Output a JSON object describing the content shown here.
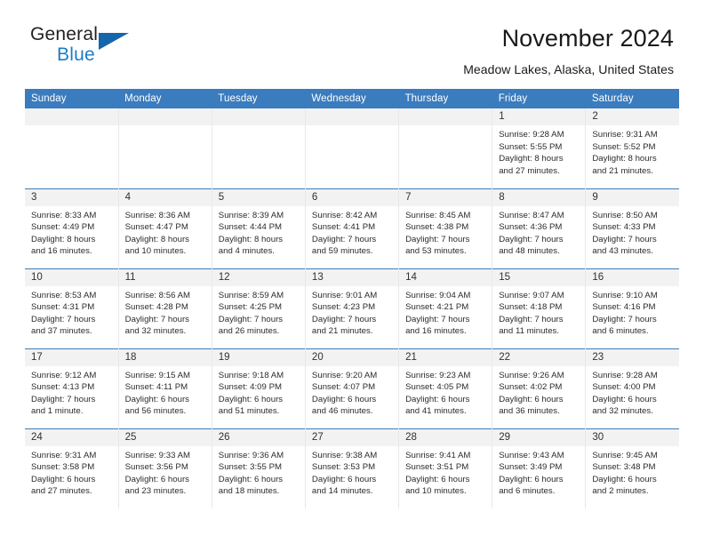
{
  "brand": {
    "name_top": "General",
    "name_bottom": "Blue",
    "accent": "#1d7cc4",
    "triangle_color": "#1566ab"
  },
  "header": {
    "title": "November 2024",
    "subtitle": "Meadow Lakes, Alaska, United States"
  },
  "calendar": {
    "header_bg": "#3a7cbe",
    "daynum_bg": "#f2f2f2",
    "weekdays": [
      "Sunday",
      "Monday",
      "Tuesday",
      "Wednesday",
      "Thursday",
      "Friday",
      "Saturday"
    ],
    "weeks": [
      [
        {
          "day": "",
          "sunrise": "",
          "sunset": "",
          "daylight1": "",
          "daylight2": "",
          "empty": true
        },
        {
          "day": "",
          "sunrise": "",
          "sunset": "",
          "daylight1": "",
          "daylight2": "",
          "empty": true
        },
        {
          "day": "",
          "sunrise": "",
          "sunset": "",
          "daylight1": "",
          "daylight2": "",
          "empty": true
        },
        {
          "day": "",
          "sunrise": "",
          "sunset": "",
          "daylight1": "",
          "daylight2": "",
          "empty": true
        },
        {
          "day": "",
          "sunrise": "",
          "sunset": "",
          "daylight1": "",
          "daylight2": "",
          "empty": true
        },
        {
          "day": "1",
          "sunrise": "Sunrise: 9:28 AM",
          "sunset": "Sunset: 5:55 PM",
          "daylight1": "Daylight: 8 hours",
          "daylight2": "and 27 minutes."
        },
        {
          "day": "2",
          "sunrise": "Sunrise: 9:31 AM",
          "sunset": "Sunset: 5:52 PM",
          "daylight1": "Daylight: 8 hours",
          "daylight2": "and 21 minutes."
        }
      ],
      [
        {
          "day": "3",
          "sunrise": "Sunrise: 8:33 AM",
          "sunset": "Sunset: 4:49 PM",
          "daylight1": "Daylight: 8 hours",
          "daylight2": "and 16 minutes."
        },
        {
          "day": "4",
          "sunrise": "Sunrise: 8:36 AM",
          "sunset": "Sunset: 4:47 PM",
          "daylight1": "Daylight: 8 hours",
          "daylight2": "and 10 minutes."
        },
        {
          "day": "5",
          "sunrise": "Sunrise: 8:39 AM",
          "sunset": "Sunset: 4:44 PM",
          "daylight1": "Daylight: 8 hours",
          "daylight2": "and 4 minutes."
        },
        {
          "day": "6",
          "sunrise": "Sunrise: 8:42 AM",
          "sunset": "Sunset: 4:41 PM",
          "daylight1": "Daylight: 7 hours",
          "daylight2": "and 59 minutes."
        },
        {
          "day": "7",
          "sunrise": "Sunrise: 8:45 AM",
          "sunset": "Sunset: 4:38 PM",
          "daylight1": "Daylight: 7 hours",
          "daylight2": "and 53 minutes."
        },
        {
          "day": "8",
          "sunrise": "Sunrise: 8:47 AM",
          "sunset": "Sunset: 4:36 PM",
          "daylight1": "Daylight: 7 hours",
          "daylight2": "and 48 minutes."
        },
        {
          "day": "9",
          "sunrise": "Sunrise: 8:50 AM",
          "sunset": "Sunset: 4:33 PM",
          "daylight1": "Daylight: 7 hours",
          "daylight2": "and 43 minutes."
        }
      ],
      [
        {
          "day": "10",
          "sunrise": "Sunrise: 8:53 AM",
          "sunset": "Sunset: 4:31 PM",
          "daylight1": "Daylight: 7 hours",
          "daylight2": "and 37 minutes."
        },
        {
          "day": "11",
          "sunrise": "Sunrise: 8:56 AM",
          "sunset": "Sunset: 4:28 PM",
          "daylight1": "Daylight: 7 hours",
          "daylight2": "and 32 minutes."
        },
        {
          "day": "12",
          "sunrise": "Sunrise: 8:59 AM",
          "sunset": "Sunset: 4:25 PM",
          "daylight1": "Daylight: 7 hours",
          "daylight2": "and 26 minutes."
        },
        {
          "day": "13",
          "sunrise": "Sunrise: 9:01 AM",
          "sunset": "Sunset: 4:23 PM",
          "daylight1": "Daylight: 7 hours",
          "daylight2": "and 21 minutes."
        },
        {
          "day": "14",
          "sunrise": "Sunrise: 9:04 AM",
          "sunset": "Sunset: 4:21 PM",
          "daylight1": "Daylight: 7 hours",
          "daylight2": "and 16 minutes."
        },
        {
          "day": "15",
          "sunrise": "Sunrise: 9:07 AM",
          "sunset": "Sunset: 4:18 PM",
          "daylight1": "Daylight: 7 hours",
          "daylight2": "and 11 minutes."
        },
        {
          "day": "16",
          "sunrise": "Sunrise: 9:10 AM",
          "sunset": "Sunset: 4:16 PM",
          "daylight1": "Daylight: 7 hours",
          "daylight2": "and 6 minutes."
        }
      ],
      [
        {
          "day": "17",
          "sunrise": "Sunrise: 9:12 AM",
          "sunset": "Sunset: 4:13 PM",
          "daylight1": "Daylight: 7 hours",
          "daylight2": "and 1 minute."
        },
        {
          "day": "18",
          "sunrise": "Sunrise: 9:15 AM",
          "sunset": "Sunset: 4:11 PM",
          "daylight1": "Daylight: 6 hours",
          "daylight2": "and 56 minutes."
        },
        {
          "day": "19",
          "sunrise": "Sunrise: 9:18 AM",
          "sunset": "Sunset: 4:09 PM",
          "daylight1": "Daylight: 6 hours",
          "daylight2": "and 51 minutes."
        },
        {
          "day": "20",
          "sunrise": "Sunrise: 9:20 AM",
          "sunset": "Sunset: 4:07 PM",
          "daylight1": "Daylight: 6 hours",
          "daylight2": "and 46 minutes."
        },
        {
          "day": "21",
          "sunrise": "Sunrise: 9:23 AM",
          "sunset": "Sunset: 4:05 PM",
          "daylight1": "Daylight: 6 hours",
          "daylight2": "and 41 minutes."
        },
        {
          "day": "22",
          "sunrise": "Sunrise: 9:26 AM",
          "sunset": "Sunset: 4:02 PM",
          "daylight1": "Daylight: 6 hours",
          "daylight2": "and 36 minutes."
        },
        {
          "day": "23",
          "sunrise": "Sunrise: 9:28 AM",
          "sunset": "Sunset: 4:00 PM",
          "daylight1": "Daylight: 6 hours",
          "daylight2": "and 32 minutes."
        }
      ],
      [
        {
          "day": "24",
          "sunrise": "Sunrise: 9:31 AM",
          "sunset": "Sunset: 3:58 PM",
          "daylight1": "Daylight: 6 hours",
          "daylight2": "and 27 minutes."
        },
        {
          "day": "25",
          "sunrise": "Sunrise: 9:33 AM",
          "sunset": "Sunset: 3:56 PM",
          "daylight1": "Daylight: 6 hours",
          "daylight2": "and 23 minutes."
        },
        {
          "day": "26",
          "sunrise": "Sunrise: 9:36 AM",
          "sunset": "Sunset: 3:55 PM",
          "daylight1": "Daylight: 6 hours",
          "daylight2": "and 18 minutes."
        },
        {
          "day": "27",
          "sunrise": "Sunrise: 9:38 AM",
          "sunset": "Sunset: 3:53 PM",
          "daylight1": "Daylight: 6 hours",
          "daylight2": "and 14 minutes."
        },
        {
          "day": "28",
          "sunrise": "Sunrise: 9:41 AM",
          "sunset": "Sunset: 3:51 PM",
          "daylight1": "Daylight: 6 hours",
          "daylight2": "and 10 minutes."
        },
        {
          "day": "29",
          "sunrise": "Sunrise: 9:43 AM",
          "sunset": "Sunset: 3:49 PM",
          "daylight1": "Daylight: 6 hours",
          "daylight2": "and 6 minutes."
        },
        {
          "day": "30",
          "sunrise": "Sunrise: 9:45 AM",
          "sunset": "Sunset: 3:48 PM",
          "daylight1": "Daylight: 6 hours",
          "daylight2": "and 2 minutes."
        }
      ]
    ]
  }
}
